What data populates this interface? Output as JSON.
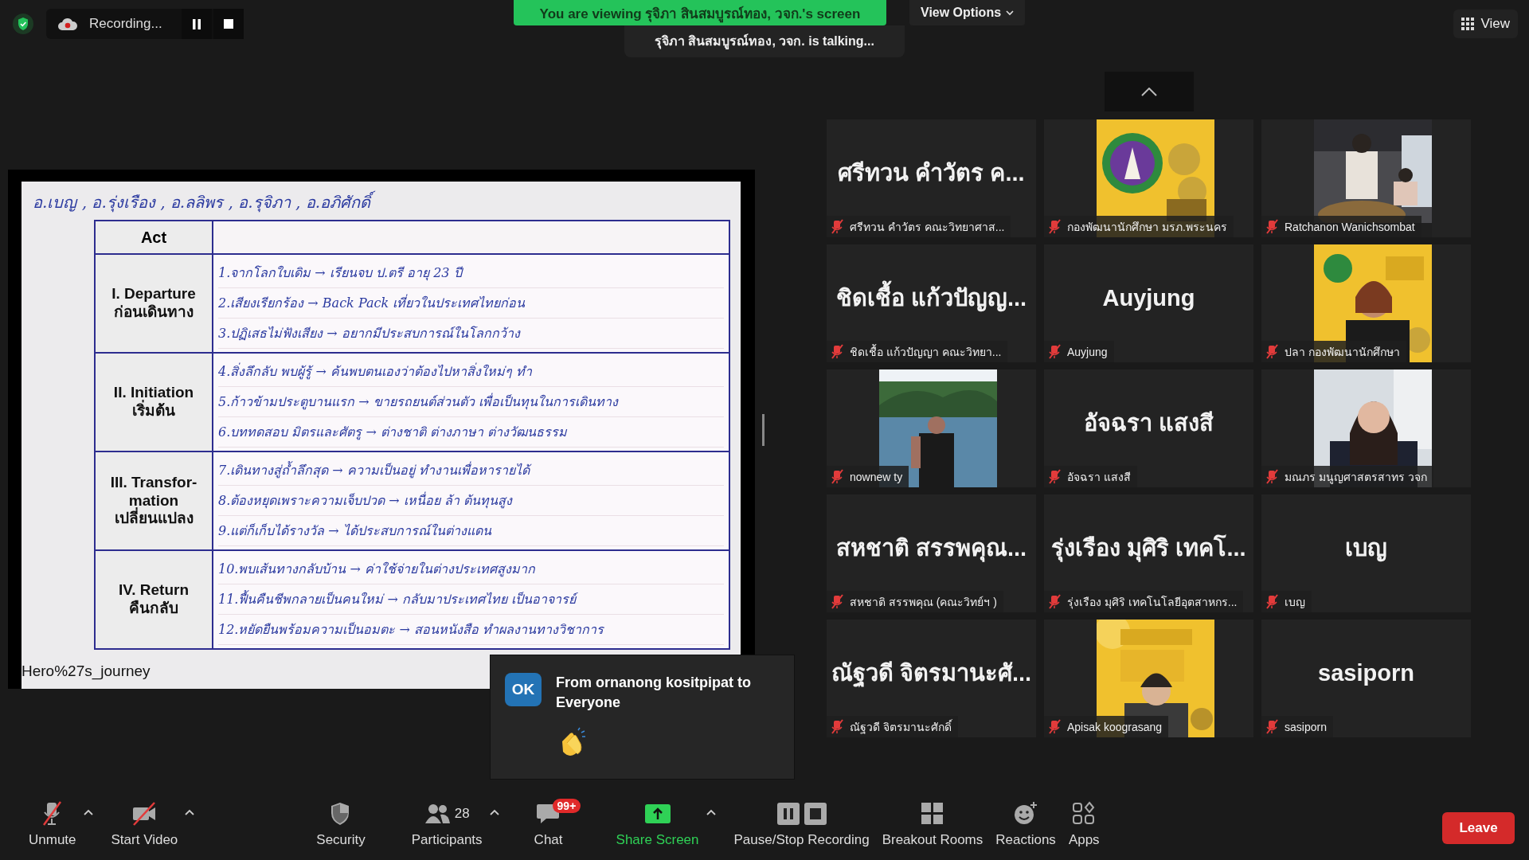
{
  "top_bar": {
    "recording": {
      "label": "Recording...",
      "paused": false
    },
    "banner": "You are viewing รุจิภา สินสมบูรณ์ทอง, วจก.'s screen",
    "talking": "รุจิภา สินสมบูรณ์ทอง, วจก. is talking...",
    "view_options": "View Options",
    "view": "View"
  },
  "shared_screen": {
    "names_line": "อ.เบญ , อ.รุ่งเรือง , อ.ลลิพร , อ.รุจิภา , อ.อภิศักดิ์",
    "table": {
      "header": "Act",
      "rows": [
        {
          "act": "I. Departure",
          "act_th": "ก่อนเดินทาง",
          "notes": [
            "1.จากโลกใบเดิม → เรียนจบ ป.ตรี อายุ 23 ปี",
            "2.เสียงเรียกร้อง → Back Pack เที่ยวในประเทศไทยก่อน",
            "3.ปฏิเสธไม่ฟังเสียง → อยากมีประสบการณ์ในโลกกว้าง"
          ]
        },
        {
          "act": "II. Initiation",
          "act_th": "เริ่มต้น",
          "notes": [
            "4.สิ่งลึกลับ พบผู้รู้ → ค้นพบตนเองว่าต้องไปหาสิ่งใหม่ๆ ทำ",
            "5.ก้าวข้ามประตูบานแรก → ขายรถยนต์ส่วนตัว เพื่อเป็นทุนในการเดินทาง",
            "6.บททดสอบ มิตรและศัตรู → ต่างชาติ ต่างภาษา ต่างวัฒนธรรม"
          ]
        },
        {
          "act": "III. Transfor-mation",
          "act_th": "เปลี่ยนแปลง",
          "notes": [
            "7.เดินทางสู่ถ้ำลึกสุด → ความเป็นอยู่ ทำงานเพื่อหารายได้",
            "8.ต้องหยุดเพราะความเจ็บปวด → เหนื่อย ล้า ต้นทุนสูง",
            "9.แต่ก็เก็บได้รางวัล → ได้ประสบการณ์ในต่างแดน"
          ]
        },
        {
          "act": "IV. Return",
          "act_th": "คืนกลับ",
          "notes": [
            "10.พบเส้นทางกลับบ้าน → ค่าใช้จ่ายในต่างประเทศสูงมาก",
            "11.ฟื้นคืนชีพกลายเป็นคนใหม่ → กลับมาประเทศไทย เป็นอาจารย์",
            "12.หยัดยืนพร้อมความเป็นอมตะ → สอนหนังสือ ทำผลงานทางวิชาการ"
          ]
        }
      ]
    },
    "caption": "Hero%27s_journey"
  },
  "gallery": [
    {
      "kind": "name",
      "display": "ศรีทวน  คำวัตร ค...",
      "label": "ศรีทวน  คำวัตร คณะวิทยาศาส...",
      "muted": true
    },
    {
      "kind": "picture",
      "label": "กองพัฒนานักศึกษา มรภ.พระนคร",
      "muted": true
    },
    {
      "kind": "picture",
      "label": "Ratchanon Wanichsombat",
      "muted": true
    },
    {
      "kind": "name",
      "display": "ชิดเชื้อ  แก้วปัญญ...",
      "label": "ชิดเชื้อ  แก้วปัญญา คณะวิทยา...",
      "muted": true
    },
    {
      "kind": "name",
      "display": "Auyjung",
      "label": "Auyjung",
      "muted": true
    },
    {
      "kind": "picture",
      "label": "ปลา กองพัฒนานักศึกษา",
      "muted": true
    },
    {
      "kind": "picture",
      "label": "nownew ty",
      "muted": true
    },
    {
      "kind": "name",
      "display": "อัจฉรา แสงสี",
      "label": "อัจฉรา แสงสี",
      "muted": true
    },
    {
      "kind": "picture",
      "label": "มณภร มนูญศาสตรสาทร วจก",
      "muted": true
    },
    {
      "kind": "name",
      "display": "สหชาติ สรรพคุณ...",
      "label": "สหชาติ สรรพคุณ (คณะวิทย์ฯ )",
      "muted": true
    },
    {
      "kind": "name",
      "display": "รุ่งเรือง มุศิริ เทคโ...",
      "label": "รุ่งเรือง มุศิริ เทคโนโลยีอุตสาหกร...",
      "muted": true
    },
    {
      "kind": "name",
      "display": "เบญ",
      "label": "เบญ",
      "muted": true
    },
    {
      "kind": "name",
      "display": "ณัฐวดี จิตรมานะศั...",
      "label": "ณัฐวดี จิตรมานะศักดิ์",
      "muted": true
    },
    {
      "kind": "picture",
      "label": "Apisak koograsang",
      "muted": true
    },
    {
      "kind": "name",
      "display": "sasiporn",
      "label": "sasiporn",
      "muted": true
    }
  ],
  "chat_popup": {
    "avatar": "OK",
    "title": "From ornanong kositpipat to Everyone"
  },
  "toolbar": [
    {
      "kind": "mic",
      "label": "Unmute",
      "off": true,
      "caret": true
    },
    {
      "kind": "video",
      "label": "Start Video",
      "off": true,
      "caret": true
    },
    {
      "kind": "security",
      "label": "Security"
    },
    {
      "kind": "participants",
      "label": "Participants",
      "count": "28",
      "caret": true
    },
    {
      "kind": "chat",
      "label": "Chat",
      "badge": "99+"
    },
    {
      "kind": "share",
      "label": "Share Screen",
      "caret": true
    },
    {
      "kind": "recording",
      "label": "Pause/Stop Recording"
    },
    {
      "kind": "breakout",
      "label": "Breakout Rooms"
    },
    {
      "kind": "reactions",
      "label": "Reactions"
    },
    {
      "kind": "apps",
      "label": "Apps"
    }
  ],
  "leave": "Leave"
}
